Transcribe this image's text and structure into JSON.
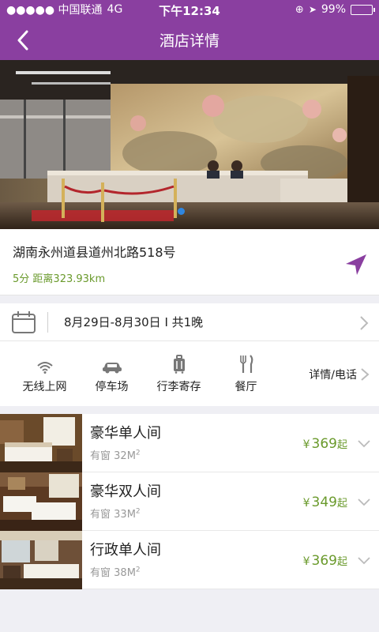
{
  "status_bar": {
    "carrier": "●●●●● 中国联通",
    "network": "4G",
    "time": "下午12:34",
    "battery": "99%",
    "battery_level": 0.99
  },
  "nav": {
    "title": "酒店详情"
  },
  "hotel": {
    "address": "湖南永州道县道州北路518号",
    "rating": "5分",
    "distance": "距离323.93km"
  },
  "booking": {
    "dates": "8月29日-8月30日 I 共1晚"
  },
  "facilities": [
    {
      "label": "无线上网",
      "icon": "wifi-icon"
    },
    {
      "label": "停车场",
      "icon": "car-icon"
    },
    {
      "label": "行李寄存",
      "icon": "luggage-icon"
    },
    {
      "label": "餐厅",
      "icon": "restaurant-icon"
    }
  ],
  "facilities_detail": "详情/电话",
  "rooms": [
    {
      "name": "豪华单人间",
      "window": "有窗",
      "area": "32M",
      "area_sup": "2",
      "yen": "¥",
      "price": "369",
      "suffix": "起"
    },
    {
      "name": "豪华双人间",
      "window": "有窗",
      "area": "33M",
      "area_sup": "2",
      "yen": "¥",
      "price": "349",
      "suffix": "起"
    },
    {
      "name": "行政单人间",
      "window": "有窗",
      "area": "38M",
      "area_sup": "2",
      "yen": "¥",
      "price": "369",
      "suffix": "起"
    }
  ],
  "colors": {
    "brand": "#8a3fa0",
    "price": "#6a9a2c",
    "background": "#efeff4"
  }
}
